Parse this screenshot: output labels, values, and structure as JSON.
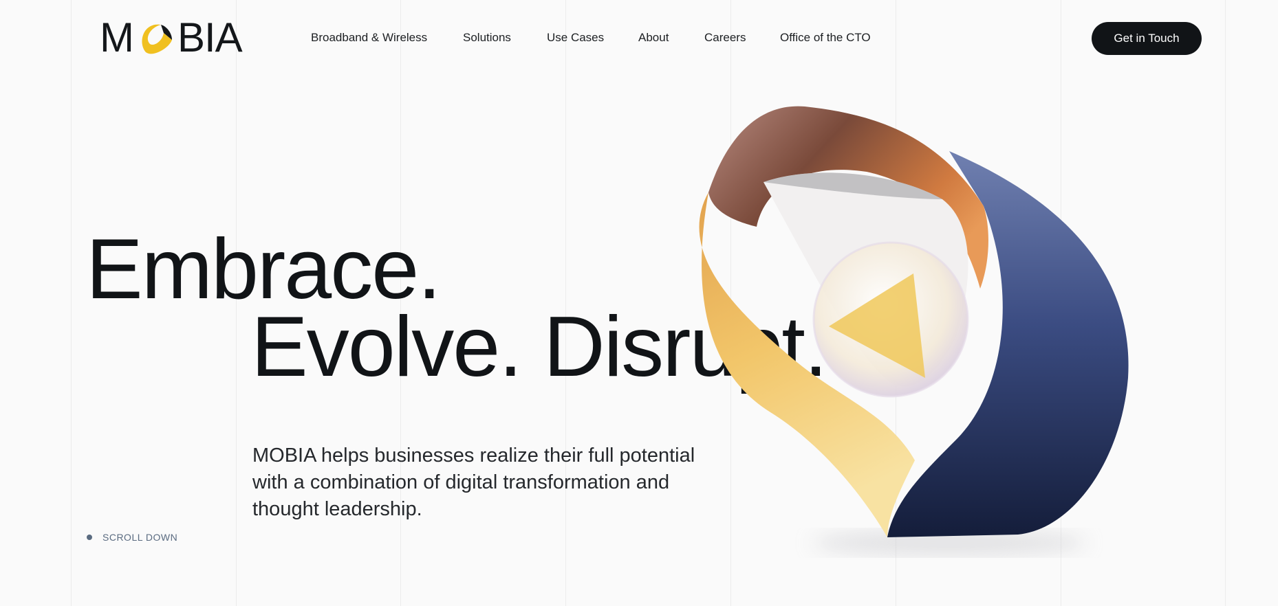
{
  "logo": {
    "text_m": "M",
    "text_bia": "BIA",
    "accent": "#f0c020"
  },
  "nav": {
    "items": [
      {
        "label": "Broadband & Wireless"
      },
      {
        "label": "Solutions"
      },
      {
        "label": "Use Cases"
      },
      {
        "label": "About"
      },
      {
        "label": "Careers"
      },
      {
        "label": "Office of the CTO"
      }
    ]
  },
  "cta": {
    "label": "Get in Touch"
  },
  "hero": {
    "line1": "Embrace.",
    "line2": "Evolve. Disrupt."
  },
  "description": "MOBIA helps businesses realize their full potential with a combination of digital transformation and thought leadership.",
  "scroll": {
    "label": "SCROLL DOWN"
  },
  "colors": {
    "dark": "#111417",
    "navy": "#2a3a6a",
    "orange": "#e9a04a",
    "yellow": "#f3c45a",
    "muted": "#5a6b80"
  }
}
